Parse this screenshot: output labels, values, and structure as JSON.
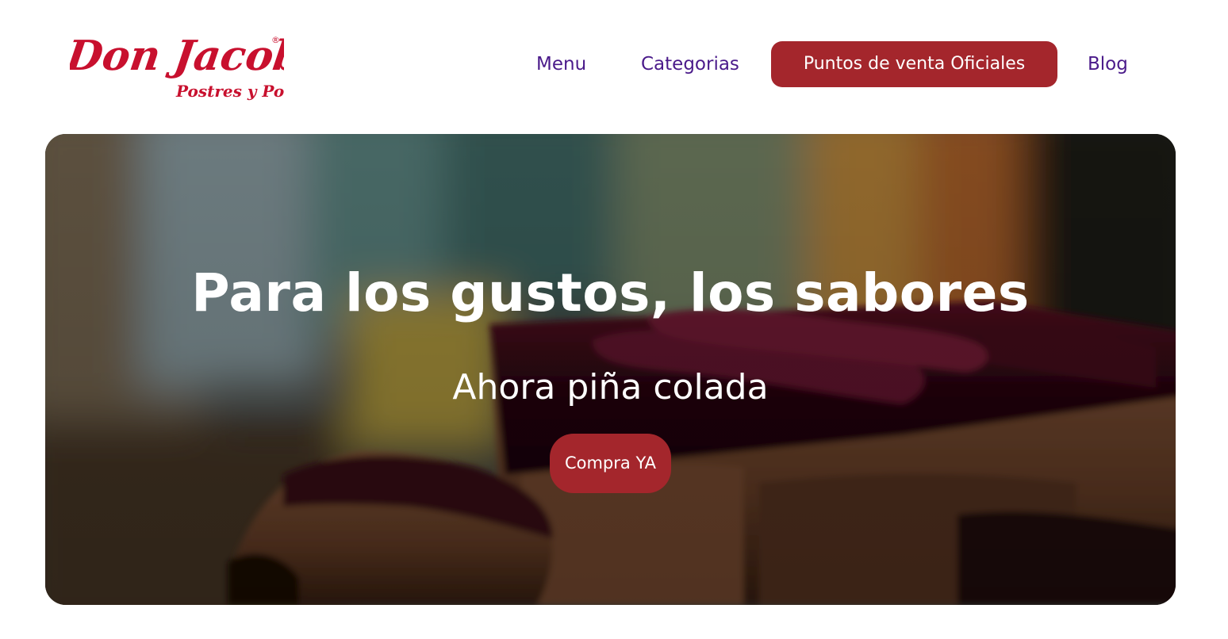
{
  "brand": {
    "name": "Don Jacobo",
    "tagline": "Postres y Ponqués",
    "registered_mark": "®",
    "color": "#c8102e"
  },
  "nav": {
    "items": [
      {
        "label": "Menu"
      },
      {
        "label": "Categorias"
      },
      {
        "label": "Puntos de venta Oficiales"
      },
      {
        "label": "Blog"
      }
    ],
    "link_color": "#4a1a8a",
    "cta_color": "#a4262c"
  },
  "hero": {
    "title": "Para los gustos, los sabores",
    "subtitle": "Ahora piña colada",
    "cta_label": "Compra YA",
    "background_image": "chocolate-cheesecake-photo",
    "cta_color": "#a4262c"
  }
}
